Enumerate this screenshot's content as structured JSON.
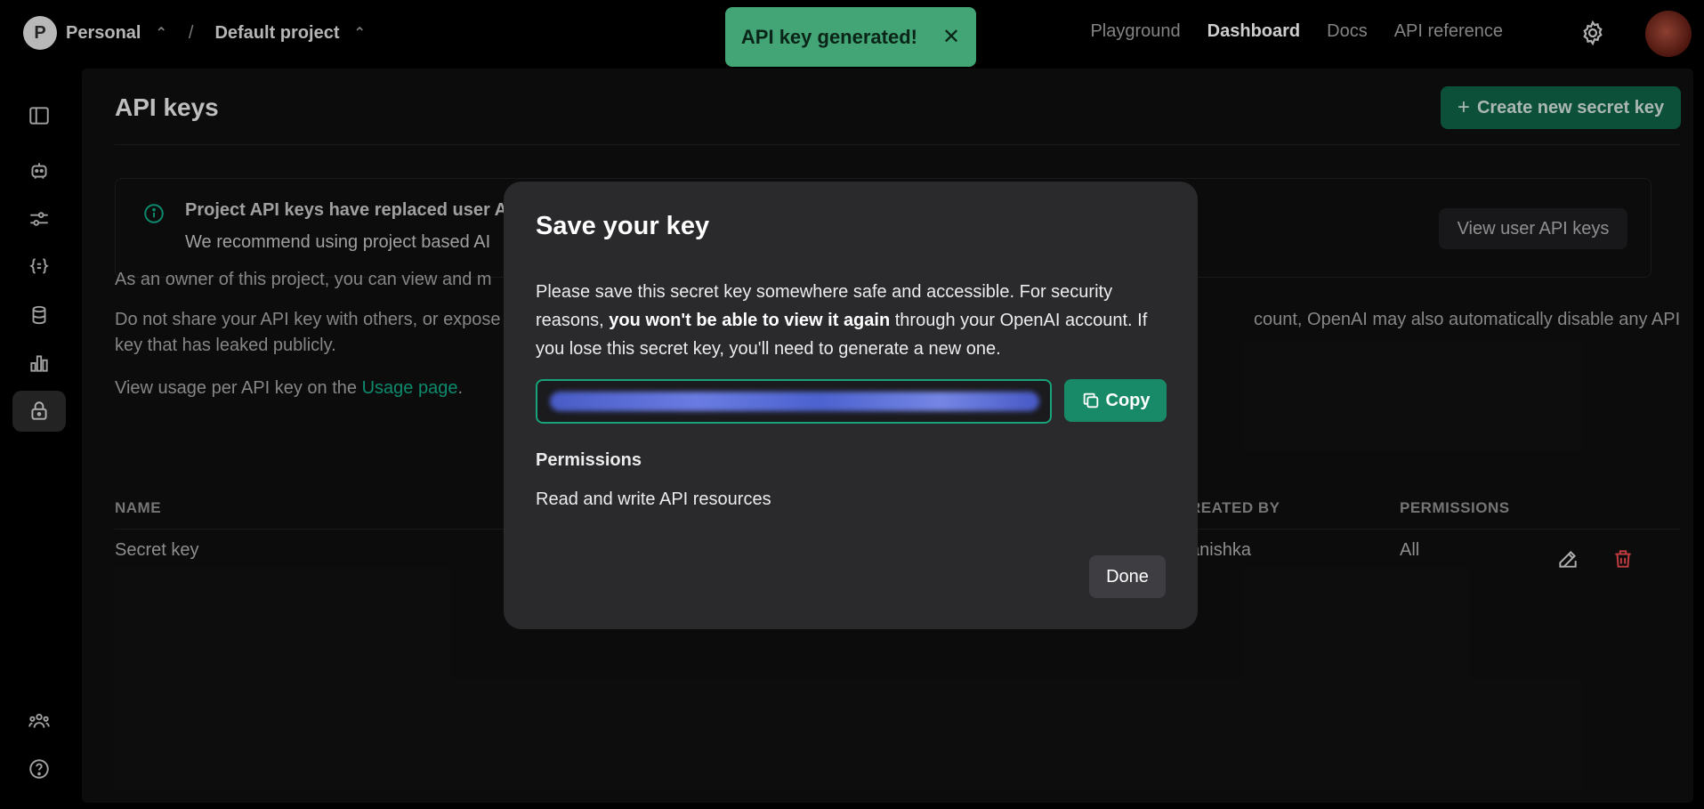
{
  "topbar": {
    "org_initial": "P",
    "org_name": "Personal",
    "separator": "/",
    "project_name": "Default project",
    "nav": [
      "Playground",
      "Dashboard",
      "Docs",
      "API reference"
    ]
  },
  "toast": {
    "message": "API key generated!",
    "close": "✕"
  },
  "page": {
    "title": "API keys",
    "create_button": "Create new secret key",
    "create_icon": "+",
    "notice_title": "Project API keys have replaced user A",
    "notice_body": "We recommend using project based AI",
    "view_user_keys": "View user API keys",
    "para1": "As an owner of this project, you can view and m",
    "para2_left": "Do not share your API key with others, or expose",
    "para2_right": "count, OpenAI may also automatically disable any API",
    "para2_line2": "key that has leaked publicly.",
    "para3_prefix": "View usage per API key on the ",
    "para3_link": "Usage page",
    "para3_suffix": ".",
    "table": {
      "headers": {
        "name": "NAME",
        "created_by": "REATED BY",
        "permissions": "PERMISSIONS"
      },
      "rows": [
        {
          "name": "Secret key",
          "created_by": "anishka",
          "permissions": "All"
        }
      ]
    }
  },
  "modal": {
    "title": "Save your key",
    "text_1": "Please save this secret key somewhere safe and accessible. For security reasons, ",
    "text_bold": "you won't be able to view it again",
    "text_2": " through your OpenAI account. If you lose this secret key, you'll need to generate a new one.",
    "copy_label": "Copy",
    "permissions_title": "Permissions",
    "permissions_value": "Read and write API resources",
    "done_label": "Done"
  },
  "colors": {
    "toast_bg": "#4fc28b",
    "accent": "#10a37f",
    "danger": "#e5484d"
  }
}
